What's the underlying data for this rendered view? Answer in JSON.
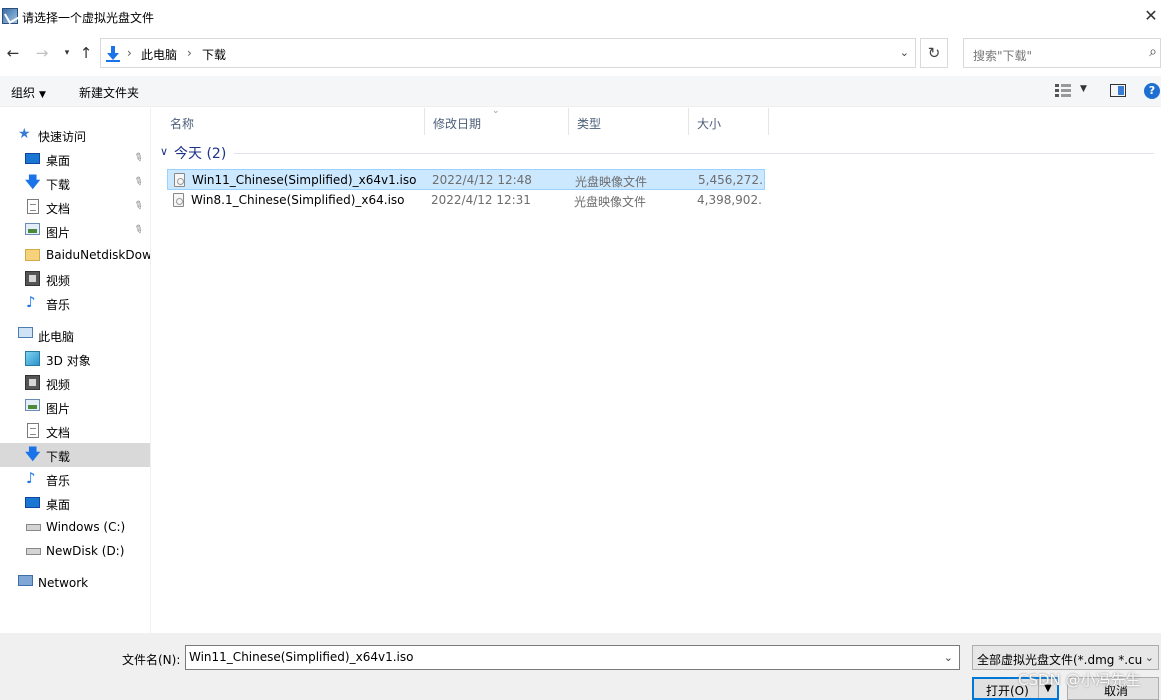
{
  "window": {
    "title": "请选择一个虚拟光盘文件",
    "close_glyph": "✕"
  },
  "address_bar": {
    "crumbs": [
      "此电脑",
      "下载"
    ],
    "search_placeholder": "搜索\"下载\""
  },
  "toolbar": {
    "organize_label": "组织",
    "new_folder_label": "新建文件夹",
    "help_glyph": "?"
  },
  "sidebar": {
    "items": [
      {
        "label": "快速访问",
        "icon": "star-icon"
      },
      {
        "label": "桌面",
        "icon": "desktop-icon",
        "pinned": true
      },
      {
        "label": "下载",
        "icon": "download-icon",
        "pinned": true
      },
      {
        "label": "文档",
        "icon": "document-icon",
        "pinned": true
      },
      {
        "label": "图片",
        "icon": "picture-icon",
        "pinned": true
      },
      {
        "label": "BaiduNetdiskDow",
        "icon": "folder-icon"
      },
      {
        "label": "视频",
        "icon": "video-icon"
      },
      {
        "label": "音乐",
        "icon": "music-icon"
      },
      {
        "label": "此电脑",
        "icon": "computer-icon"
      },
      {
        "label": "3D 对象",
        "icon": "3d-objects-icon"
      },
      {
        "label": "视频",
        "icon": "video-icon"
      },
      {
        "label": "图片",
        "icon": "picture-icon"
      },
      {
        "label": "文档",
        "icon": "document-icon"
      },
      {
        "label": "下载",
        "icon": "download-icon",
        "selected": true
      },
      {
        "label": "音乐",
        "icon": "music-icon"
      },
      {
        "label": "桌面",
        "icon": "desktop-icon"
      },
      {
        "label": "Windows (C:)",
        "icon": "drive-icon"
      },
      {
        "label": "NewDisk (D:)",
        "icon": "drive-icon"
      },
      {
        "label": "Network",
        "icon": "network-icon"
      }
    ]
  },
  "file_list": {
    "columns": [
      "名称",
      "修改日期",
      "类型",
      "大小"
    ],
    "group_label": "今天 (2)",
    "rows": [
      {
        "name": "Win11_Chinese(Simplified)_x64v1.iso",
        "date": "2022/4/12 12:48",
        "type": "光盘映像文件",
        "size": "5,456,272...",
        "selected": true
      },
      {
        "name": "Win8.1_Chinese(Simplified)_x64.iso",
        "date": "2022/4/12 12:31",
        "type": "光盘映像文件",
        "size": "4,398,902...",
        "selected": false
      }
    ]
  },
  "bottom": {
    "filename_label": "文件名(N):",
    "filename_value": "Win11_Chinese(Simplified)_x64v1.iso",
    "filter_value": "全部虚拟光盘文件(*.dmg *.cue",
    "open_label": "打开(O)",
    "cancel_label": "取消"
  },
  "watermark": "CSDN @小冯先生",
  "colors": {
    "selection_bg": "#cce8ff",
    "selection_border": "#99d1ff",
    "group_header": "#1e3287",
    "accent": "#0078d7"
  }
}
